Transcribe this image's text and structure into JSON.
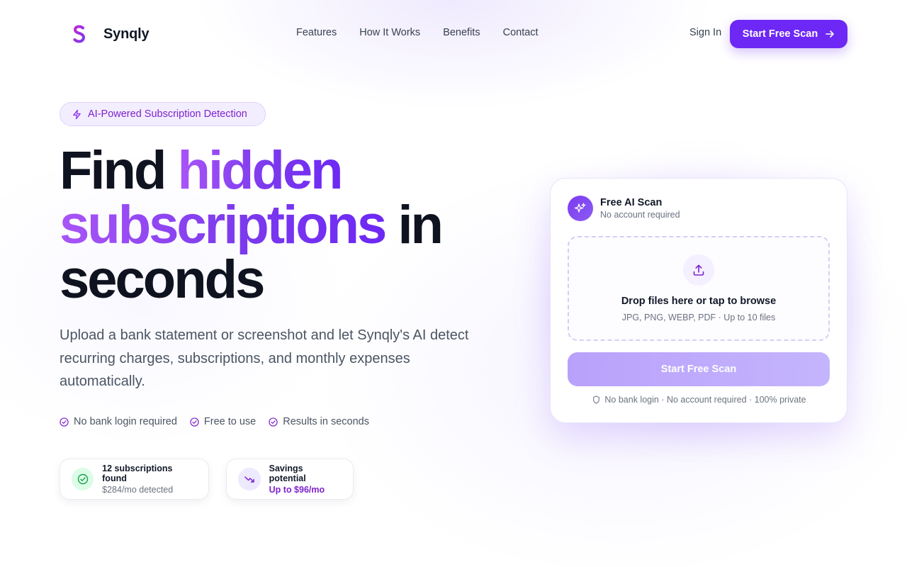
{
  "brand": {
    "name": "Synqly",
    "accent": "#6d28f5",
    "gradient_start": "#a855f7",
    "gradient_end": "#6d28f5"
  },
  "nav": {
    "links": [
      "Features",
      "How It Works",
      "Benefits",
      "Contact"
    ],
    "signin_label": "Sign In",
    "cta_label": "Start Free Scan",
    "cta_icon": "arrow-right-icon"
  },
  "hero": {
    "badge": {
      "icon": "lightning-icon",
      "text": "AI-Powered Subscription Detection"
    },
    "headline": {
      "part1": "Find",
      "highlight1": "hidden",
      "highlight2": "subscriptions",
      "part2": "in",
      "part3": "seconds"
    },
    "subtext": "Upload a bank statement or screenshot and let Synqly's AI detect recurring charges, subscriptions, and monthly expenses automatically.",
    "checks": [
      "No bank login required",
      "Free to use",
      "Results in seconds"
    ],
    "stats": [
      {
        "icon": "check-circle-icon",
        "title": "12 subscriptions found",
        "sub": "$284/mo detected"
      },
      {
        "icon": "trending-down-icon",
        "title": "Savings potential",
        "sub": "Up to $96/mo"
      }
    ]
  },
  "scan_card": {
    "icon": "sparkles-icon",
    "title": "Free AI Scan",
    "subtitle": "No account required",
    "dropzone": {
      "icon": "upload-icon",
      "title": "Drop files here or tap to browse",
      "formats": "JPG, PNG, WEBP, PDF · Up to 10 files"
    },
    "button_label": "Start Free Scan",
    "privacy_icon": "shield-icon",
    "privacy_text": "No bank login · No account required · 100% private"
  }
}
